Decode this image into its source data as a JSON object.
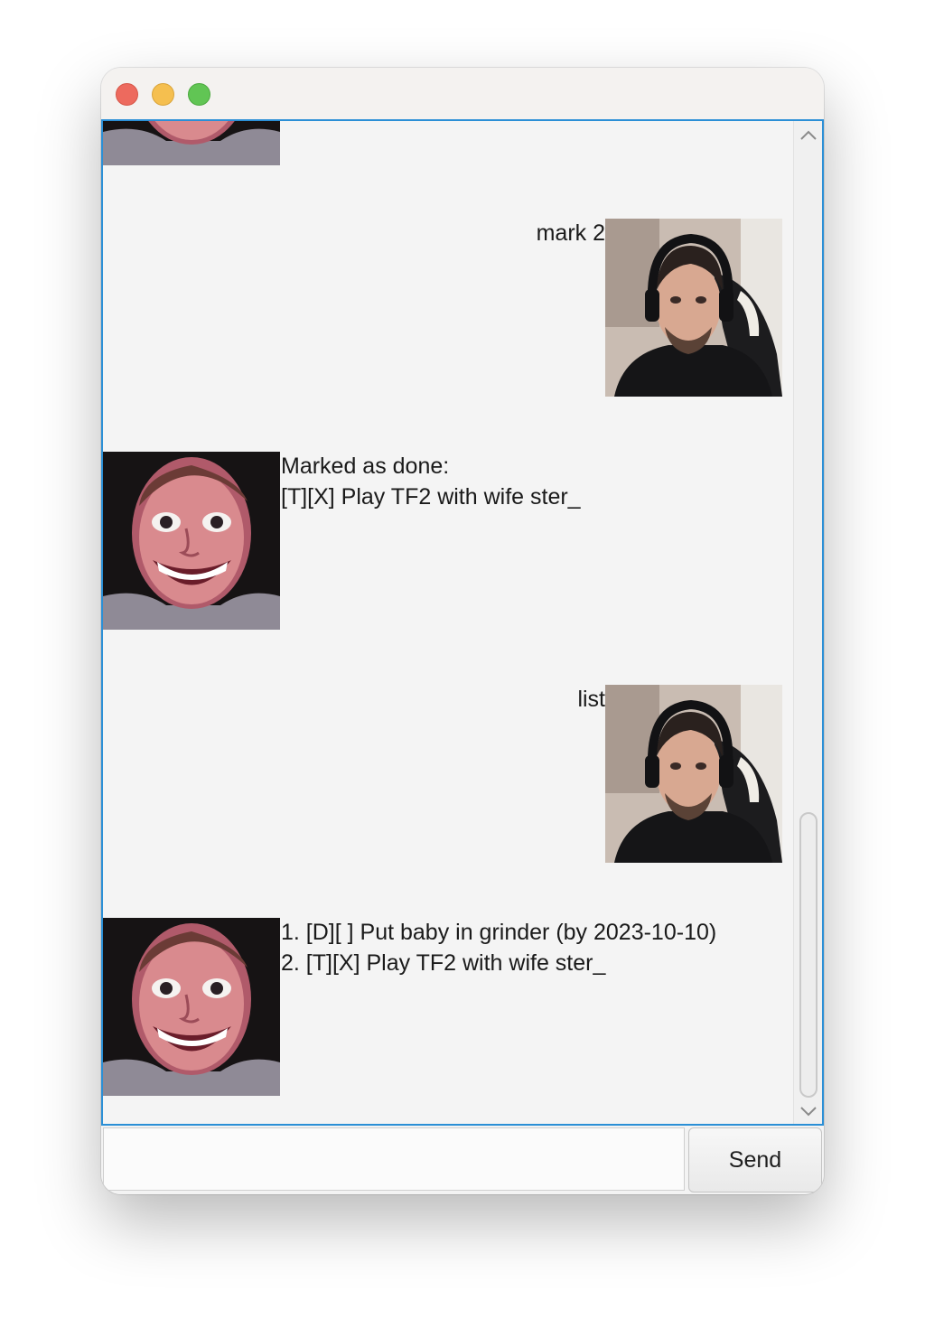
{
  "window": {
    "controls": [
      "close",
      "minimize",
      "zoom"
    ]
  },
  "messages": [
    {
      "sender": "bot",
      "avatar": "grinning-man-avatar",
      "lines": []
    },
    {
      "sender": "user",
      "avatar": "headset-man-avatar",
      "lines": [
        "mark 2"
      ]
    },
    {
      "sender": "bot",
      "avatar": "grinning-man-avatar",
      "lines": [
        "Marked as done:",
        "[T][X] Play TF2 with wife ster_"
      ]
    },
    {
      "sender": "user",
      "avatar": "headset-man-avatar",
      "lines": [
        "list"
      ]
    },
    {
      "sender": "bot",
      "avatar": "grinning-man-avatar",
      "lines": [
        "1. [D][ ] Put baby in grinder (by 2023-10-10)",
        "2. [T][X] Play TF2 with wife ster_"
      ]
    }
  ],
  "input": {
    "value": "",
    "placeholder": ""
  },
  "send_button": {
    "label": "Send"
  },
  "scrollbar": {
    "up_icon": "chevron-up-icon",
    "down_icon": "chevron-down-icon",
    "position": 1.0
  },
  "colors": {
    "focus_border": "#2b8fd6",
    "background": "#f4f4f4",
    "close": "#ed6a5e",
    "minimize": "#f5bf4f",
    "zoom": "#61c554"
  }
}
